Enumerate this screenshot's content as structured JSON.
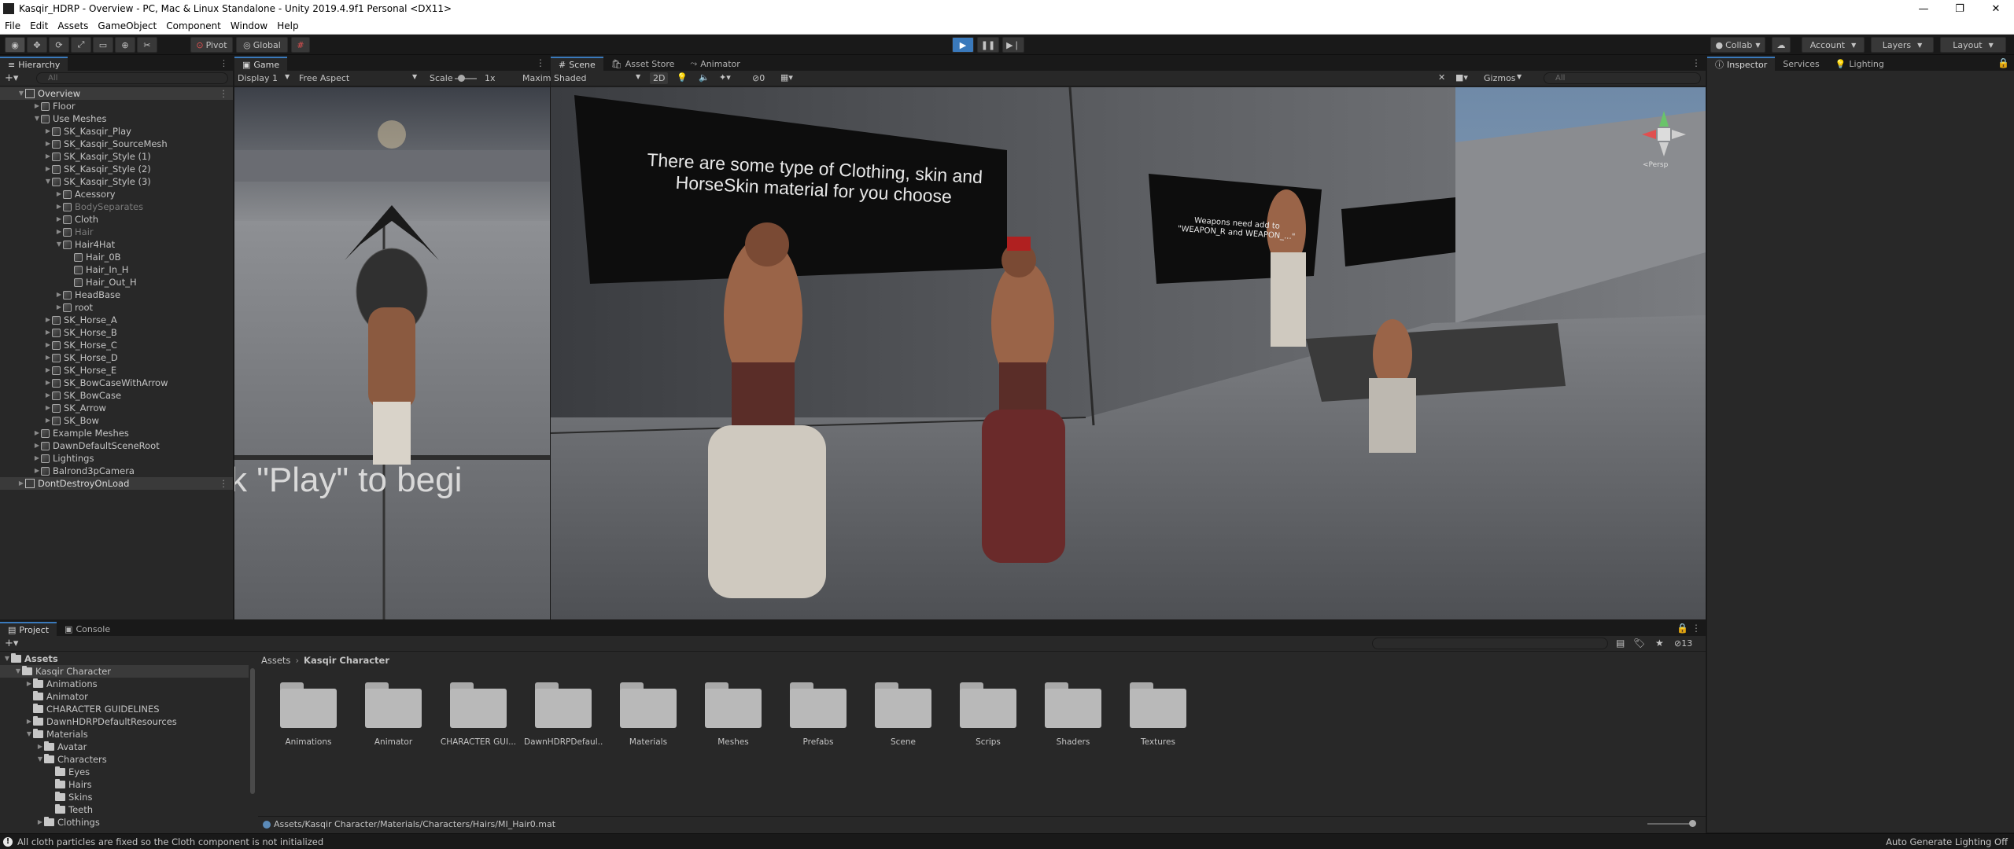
{
  "window": {
    "title": "Kasqir_HDRP - Overview - PC, Mac & Linux Standalone - Unity 2019.4.9f1 Personal <DX11>"
  },
  "menu": [
    "File",
    "Edit",
    "Assets",
    "GameObject",
    "Component",
    "Window",
    "Help"
  ],
  "toolbar": {
    "pivot": "Pivot",
    "global": "Global",
    "collab": "Collab",
    "account": "Account",
    "layers": "Layers",
    "layout": "Layout"
  },
  "hierarchy": {
    "tab": "Hierarchy",
    "search_placeholder": "All",
    "rows": [
      {
        "label": "Overview",
        "depth": 0,
        "type": "scene",
        "expanded": true,
        "selected": true
      },
      {
        "label": "Floor",
        "depth": 1,
        "type": "obj",
        "expanded": false
      },
      {
        "label": "Use Meshes",
        "depth": 1,
        "type": "obj",
        "expanded": true
      },
      {
        "label": "SK_Kasqir_Play",
        "depth": 2,
        "type": "obj",
        "expanded": false
      },
      {
        "label": "SK_Kasqir_SourceMesh",
        "depth": 2,
        "type": "obj",
        "expanded": false
      },
      {
        "label": "SK_Kasqir_Style (1)",
        "depth": 2,
        "type": "obj",
        "expanded": false
      },
      {
        "label": "SK_Kasqir_Style (2)",
        "depth": 2,
        "type": "obj",
        "expanded": false
      },
      {
        "label": "SK_Kasqir_Style (3)",
        "depth": 2,
        "type": "obj",
        "expanded": true
      },
      {
        "label": "Acessory",
        "depth": 3,
        "type": "obj",
        "expanded": false
      },
      {
        "label": "BodySeparates",
        "depth": 3,
        "type": "obj",
        "expanded": false,
        "dim": true
      },
      {
        "label": "Cloth",
        "depth": 3,
        "type": "obj",
        "expanded": false
      },
      {
        "label": "Hair",
        "depth": 3,
        "type": "obj",
        "expanded": false,
        "dim": true
      },
      {
        "label": "Hair4Hat",
        "depth": 3,
        "type": "obj",
        "expanded": true
      },
      {
        "label": "Hair_0B",
        "depth": 4,
        "type": "obj",
        "leaf": true
      },
      {
        "label": "Hair_In_H",
        "depth": 4,
        "type": "obj",
        "leaf": true
      },
      {
        "label": "Hair_Out_H",
        "depth": 4,
        "type": "obj",
        "leaf": true
      },
      {
        "label": "HeadBase",
        "depth": 3,
        "type": "obj",
        "expanded": false
      },
      {
        "label": "root",
        "depth": 3,
        "type": "obj",
        "expanded": false
      },
      {
        "label": "SK_Horse_A",
        "depth": 2,
        "type": "obj",
        "expanded": false
      },
      {
        "label": "SK_Horse_B",
        "depth": 2,
        "type": "obj",
        "expanded": false
      },
      {
        "label": "SK_Horse_C",
        "depth": 2,
        "type": "obj",
        "expanded": false
      },
      {
        "label": "SK_Horse_D",
        "depth": 2,
        "type": "obj",
        "expanded": false
      },
      {
        "label": "SK_Horse_E",
        "depth": 2,
        "type": "obj",
        "expanded": false
      },
      {
        "label": "SK_BowCaseWithArrow",
        "depth": 2,
        "type": "obj",
        "expanded": false
      },
      {
        "label": "SK_BowCase",
        "depth": 2,
        "type": "obj",
        "expanded": false
      },
      {
        "label": "SK_Arrow",
        "depth": 2,
        "type": "obj",
        "expanded": false
      },
      {
        "label": "SK_Bow",
        "depth": 2,
        "type": "obj",
        "expanded": false
      },
      {
        "label": "Example Meshes",
        "depth": 1,
        "type": "obj",
        "expanded": false
      },
      {
        "label": "DawnDefaultSceneRoot",
        "depth": 1,
        "type": "obj",
        "expanded": false
      },
      {
        "label": "Lightings",
        "depth": 1,
        "type": "obj",
        "expanded": false
      },
      {
        "label": "Balrond3pCamera",
        "depth": 1,
        "type": "obj",
        "expanded": false
      },
      {
        "label": "DontDestroyOnLoad",
        "depth": 0,
        "type": "scene",
        "expanded": false,
        "selected": true
      }
    ]
  },
  "game": {
    "tab": "Game",
    "display": "Display 1",
    "aspect": "Free Aspect",
    "scale_label": "Scale",
    "scale_value": "1x",
    "maximize": "Maxim",
    "overlay_text": "k \"Play\" to begi"
  },
  "scene": {
    "tabs": [
      "Scene",
      "Asset Store",
      "Animator"
    ],
    "shading": "Shaded",
    "mode2d": "2D",
    "fx_count": "0",
    "gizmos": "Gizmos",
    "search_placeholder": "All",
    "persp": "<Persp",
    "sign_text": "There are some type of Clothing, skin and HorseSkin material for you choose",
    "sign2_text": "Weapons need add to \"WEAPON_R and WEAPON_...\""
  },
  "inspector": {
    "tabs": [
      "Inspector",
      "Services",
      "Lighting"
    ]
  },
  "project": {
    "tabs": [
      "Project",
      "Console"
    ],
    "hidden_count": "13",
    "breadcrumb": [
      "Assets",
      "Kasqir Character"
    ],
    "tree": [
      {
        "label": "Assets",
        "depth": 0,
        "expanded": true,
        "bold": true
      },
      {
        "label": "Kasqir Character",
        "depth": 1,
        "expanded": true,
        "selected": true
      },
      {
        "label": "Animations",
        "depth": 2,
        "expanded": false
      },
      {
        "label": "Animator",
        "depth": 2,
        "leaf": true
      },
      {
        "label": "CHARACTER GUIDELINES",
        "depth": 2,
        "leaf": true
      },
      {
        "label": "DawnHDRPDefaultResources",
        "depth": 2,
        "expanded": false
      },
      {
        "label": "Materials",
        "depth": 2,
        "expanded": true
      },
      {
        "label": "Avatar",
        "depth": 3,
        "expanded": false
      },
      {
        "label": "Characters",
        "depth": 3,
        "expanded": true
      },
      {
        "label": "Eyes",
        "depth": 4,
        "leaf": true
      },
      {
        "label": "Hairs",
        "depth": 4,
        "leaf": true
      },
      {
        "label": "Skins",
        "depth": 4,
        "leaf": true
      },
      {
        "label": "Teeth",
        "depth": 4,
        "leaf": true
      },
      {
        "label": "Clothings",
        "depth": 3,
        "expanded": false
      }
    ],
    "folders": [
      "Animations",
      "Animator",
      "CHARACTER GUI...",
      "DawnHDRPDefaul...",
      "Materials",
      "Meshes",
      "Prefabs",
      "Scene",
      "Scrips",
      "Shaders",
      "Textures"
    ],
    "path": "Assets/Kasqir Character/Materials/Characters/Hairs/MI_Hair0.mat"
  },
  "status": {
    "message": "All cloth particles are fixed so the Cloth component is not initialized",
    "right": "Auto Generate Lighting Off"
  }
}
